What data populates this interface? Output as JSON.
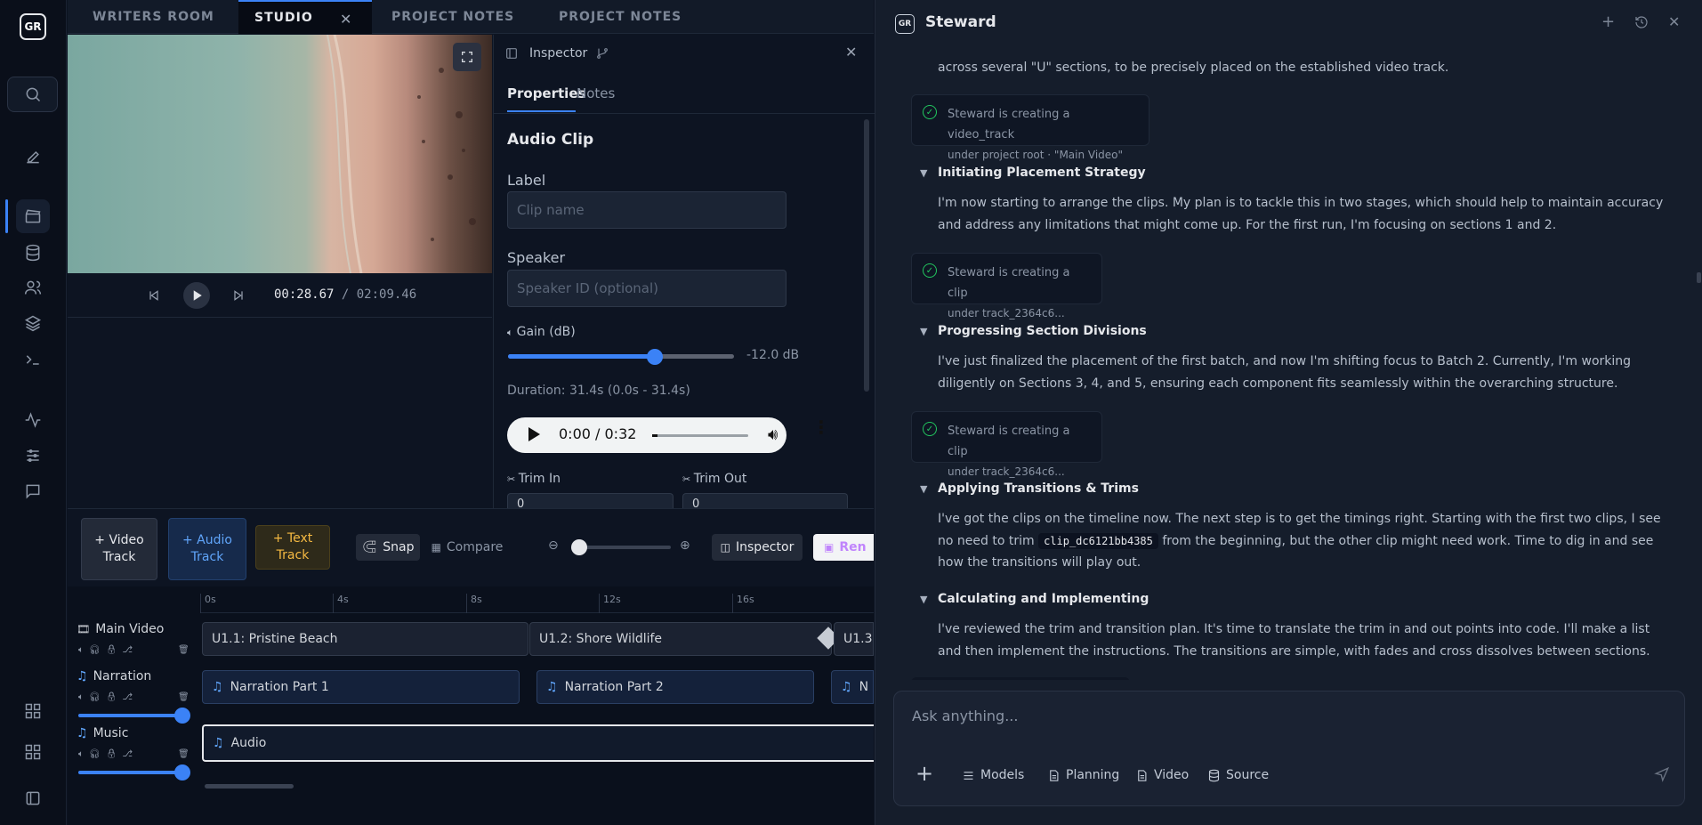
{
  "sidebar": {
    "logo": "GR"
  },
  "tabs": [
    {
      "label": "WRITERS ROOM"
    },
    {
      "label": "STUDIO"
    },
    {
      "label": "PROJECT NOTES"
    },
    {
      "label": "PROJECT NOTES"
    }
  ],
  "player": {
    "current_time": "00:28.67",
    "total_time": "/ 02:09.46"
  },
  "inspector": {
    "title": "Inspector",
    "tabs": [
      "Properties",
      "Notes"
    ],
    "heading": "Audio Clip",
    "label_field": {
      "label": "Label",
      "placeholder": "Clip name"
    },
    "speaker_field": {
      "label": "Speaker",
      "placeholder": "Speaker ID (optional)"
    },
    "gain": {
      "label": "Gain (dB)",
      "value": "-12.0 dB",
      "fraction": 0.65
    },
    "duration": "Duration: 31.4s (0.0s - 31.4s)",
    "audio_time": "0:00 / 0:32",
    "trim_in": {
      "label": "Trim In",
      "value": "0"
    },
    "trim_out": {
      "label": "Trim Out",
      "value": "0"
    }
  },
  "toolbar": {
    "video_track": "+ Video Track",
    "audio_track": "+ Audio Track",
    "text_track": "+ Text Track",
    "snap": "Snap",
    "compare": "Compare",
    "inspector": "Inspector",
    "render": "Ren",
    "accent": "#3b82f6"
  },
  "timeline": {
    "ticks": [
      "0s",
      "4s",
      "8s",
      "12s",
      "16s"
    ],
    "tracks": [
      {
        "name": "Main Video"
      },
      {
        "name": "Narration",
        "volume": 1.0
      },
      {
        "name": "Music",
        "volume": 1.0
      }
    ],
    "video_clips": [
      "U1.1: Pristine Beach",
      "U1.2: Shore Wildlife",
      "U1.3:"
    ],
    "narration_clips": [
      "Narration Part 1",
      "Narration Part 2",
      "N"
    ],
    "music_clips": [
      "Audio"
    ]
  },
  "steward": {
    "title": "Steward",
    "intro_text": "across several \"U\" sections, to be precisely placed on the established video track.",
    "cards": [
      {
        "title": "Steward is creating a video_track",
        "sub": "under project root · \"Main Video\""
      },
      {
        "title": "Steward is creating a clip",
        "sub": "under track_2364c6..."
      },
      {
        "title": "Steward is creating a clip",
        "sub": "under track_2364c6..."
      }
    ],
    "sections": [
      {
        "title": "Initiating Placement Strategy",
        "text": "I'm now starting to arrange the clips. My plan is to tackle this in two stages, which should help to maintain accuracy and address any limitations that might come up. For the first run, I'm focusing on sections 1 and 2."
      },
      {
        "title": "Progressing Section Divisions",
        "text": "I've just finalized the placement of the first batch, and now I'm shifting focus to Batch 2. Currently, I'm working diligently on Sections 3, 4, and 5, ensuring each component fits seamlessly within the overarching structure."
      },
      {
        "title": "Applying Transitions & Trims",
        "text_a": "I've got the clips on the timeline now. The next step is to get the timings right. Starting with the first two clips, I see no need to trim",
        "code": "clip_dc6121bb4385",
        "text_b": "from the beginning, but the other clip might need work. Time to dig in and see how the transitions will play out."
      },
      {
        "title": "Calculating and Implementing",
        "text": "I've reviewed the trim and transition plan. It's time to translate the trim in and out points into code. I'll make a list and then implement the instructions. The transitions are simple, with fades and cross dissolves between sections."
      }
    ],
    "input_placeholder": "Ask anything...",
    "buttons": [
      "Models",
      "Planning",
      "Video",
      "Source"
    ]
  }
}
